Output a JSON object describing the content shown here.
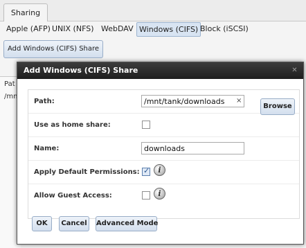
{
  "background": {
    "top_tab": "Sharing",
    "share_tabs": [
      "Apple (AFP)",
      "UNIX (NFS)",
      "WebDAV",
      "Windows (CIFS)",
      "Block (iSCSI)"
    ],
    "active_share_tab": "Windows (CIFS)",
    "add_button_label": "Add Windows (CIFS) Share",
    "list_fragments": [
      "Pat",
      "/mn"
    ]
  },
  "dialog": {
    "title": "Add Windows (CIFS) Share",
    "close_icon": "close-icon",
    "fields": {
      "path": {
        "label": "Path:",
        "value": "/mnt/tank/downloads",
        "clear_glyph": "×",
        "browse_label": "Browse"
      },
      "home_share": {
        "label": "Use as home share:",
        "checked": false
      },
      "name": {
        "label": "Name:",
        "value": "downloads"
      },
      "default_permissions": {
        "label": "Apply Default Permissions:",
        "checked": true,
        "info_icon": "info-icon"
      },
      "guest_access": {
        "label": "Allow Guest Access:",
        "checked": false,
        "info_icon": "info-icon"
      }
    },
    "buttons": {
      "ok": "OK",
      "cancel": "Cancel",
      "advanced": "Advanced Mode"
    },
    "info_glyph": "i"
  },
  "colors": {
    "title_bar": "#2b2b2b",
    "button_border": "#98adc7",
    "active_tab": "#d8e4f2"
  }
}
